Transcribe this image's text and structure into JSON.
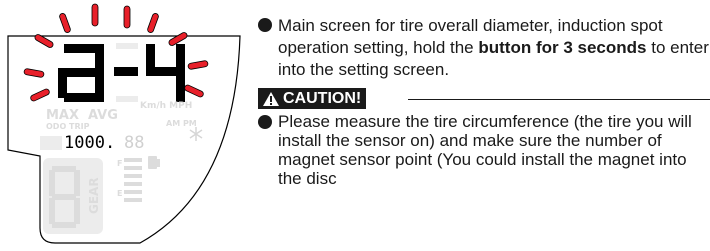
{
  "display": {
    "main_digits": "a-4",
    "speed_units": "Km/h MPH",
    "max_label": "MAX",
    "avg_label": "AVG",
    "odo_trip_label": "ODO TRIP",
    "clock_label": "AM PM",
    "gear_label": "GEAR",
    "odo_reading": "1000.",
    "odo_reading_faint": "88"
  },
  "instructions": {
    "para1_text_before": "Main screen for tire overall diameter, induction spot operation setting, hold the ",
    "para1_bold": "button for 3 seconds",
    "para1_text_after": " to enter into the setting screen.",
    "caution_label": "CAUTION!",
    "para2_text": "Please measure the tire circumference (the tire you will install the sensor on) and make sure the number of magnet sensor point (You could install the magnet into the disc"
  },
  "colors": {
    "flash_red": "#e8202a",
    "lcd_segment": "#000000",
    "lcd_ghost": "#ececec"
  },
  "icons": [
    "flash-ray-icon",
    "warning-triangle-icon",
    "fuel-pump-icon",
    "snowflake-icon"
  ]
}
